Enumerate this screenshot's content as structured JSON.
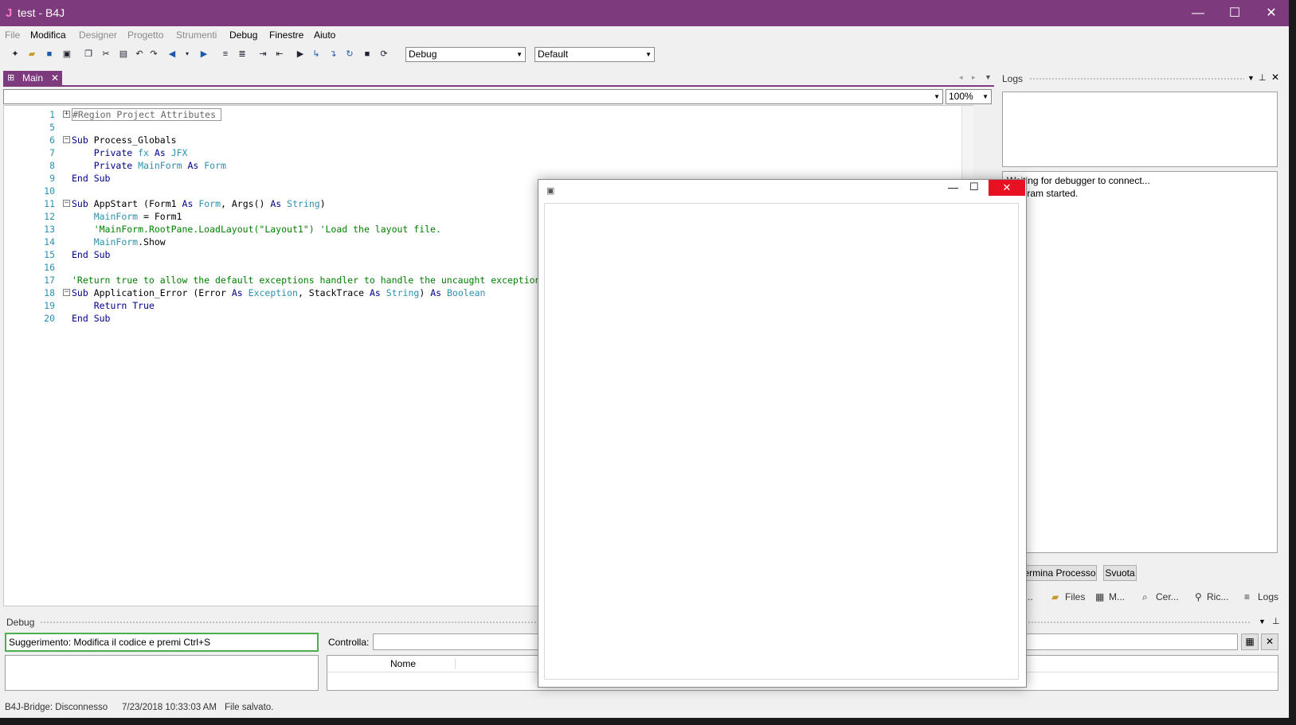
{
  "window": {
    "app_icon": "J",
    "title": "test - B4J",
    "controls": {
      "minimize": "—",
      "maximize": "☐",
      "close": "✕"
    }
  },
  "menu": {
    "items": [
      {
        "label": "File",
        "enabled": false
      },
      {
        "label": "Modifica",
        "enabled": true
      },
      {
        "label": "Designer",
        "enabled": false
      },
      {
        "label": "Progetto",
        "enabled": false
      },
      {
        "label": "Strumenti",
        "enabled": false
      },
      {
        "label": "Debug",
        "enabled": true
      },
      {
        "label": "Finestre",
        "enabled": true
      },
      {
        "label": "Aiuto",
        "enabled": true
      }
    ]
  },
  "toolbar": {
    "build_config": "Debug",
    "platform": "Default"
  },
  "editor": {
    "tab_label": "Main",
    "tab_close": "✕",
    "zoom": "100%",
    "lines": [
      {
        "n": "1",
        "region": "#Region Project Attributes"
      },
      {
        "n": "5"
      },
      {
        "n": "6"
      },
      {
        "n": "7"
      },
      {
        "n": "8"
      },
      {
        "n": "9"
      },
      {
        "n": "10"
      },
      {
        "n": "11"
      },
      {
        "n": "12"
      },
      {
        "n": "13"
      },
      {
        "n": "14"
      },
      {
        "n": "15"
      },
      {
        "n": "16"
      },
      {
        "n": "17"
      },
      {
        "n": "18"
      },
      {
        "n": "19"
      },
      {
        "n": "20"
      }
    ],
    "code": {
      "l6_kw": "Sub",
      "l6_name": "Process_Globals",
      "l7_a": "Private",
      "l7_b": "fx",
      "l7_c": "As",
      "l7_d": "JFX",
      "l8_a": "Private",
      "l8_b": "MainForm",
      "l8_c": "As",
      "l8_d": "Form",
      "l9": "End Sub",
      "l11_a": "Sub",
      "l11_b": "AppStart",
      "l11_c": "(Form1",
      "l11_d": "As",
      "l11_e": "Form",
      "l11_f": ", Args()",
      "l11_g": "As",
      "l11_h": "String",
      "l11_i": ")",
      "l12_a": "MainForm",
      "l12_b": " = Form1",
      "l13": "'MainForm.RootPane.LoadLayout(\"Layout1\") 'Load the layout file.",
      "l14_a": "MainForm",
      "l14_b": ".Show",
      "l15": "End Sub",
      "l17": "'Return true to allow the default exceptions handler to handle the uncaught exception",
      "l18_a": "Sub",
      "l18_b": "Application_Error",
      "l18_c": "(Error",
      "l18_d": "As",
      "l18_e": "Exception",
      "l18_f": ", StackTrace",
      "l18_g": "As",
      "l18_h": "String",
      "l18_i": ")",
      "l18_j": "As",
      "l18_k": "Boolean",
      "l19_a": "Return",
      "l19_b": "True",
      "l20": "End Sub"
    }
  },
  "logs": {
    "title": "Logs",
    "line1": "Waiting for debugger to connect...",
    "line2": "Program started.",
    "kill_button": "Termina Processo",
    "clear_button": "Svuota",
    "tabs": [
      "Mo...",
      "Files",
      "M...",
      "Cer...",
      "Ric...",
      "Logs"
    ]
  },
  "debug": {
    "title": "Debug",
    "hint": "Suggerimento: Modifica il codice e premi Ctrl+S",
    "watch_label": "Controlla:",
    "column_name": "Nome"
  },
  "status": {
    "bridge": "B4J-Bridge: Disconnesso",
    "timestamp": "7/23/2018 10:33:03 AM",
    "message": "File salvato."
  },
  "form_window": {
    "minimize": "—",
    "maximize": "☐",
    "close": "✕"
  }
}
